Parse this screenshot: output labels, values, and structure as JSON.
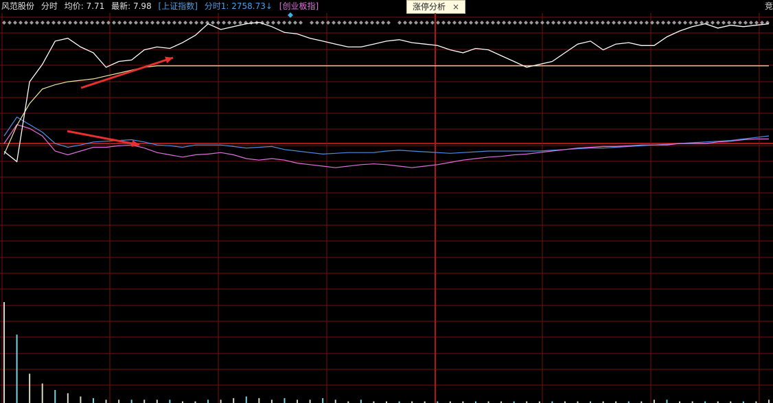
{
  "header": {
    "stock": "风范股份",
    "mode": "分时",
    "avg_label": "均价:",
    "avg_value": "7.71",
    "last_label": "最新:",
    "last_value": "7.98",
    "index_name": "[上证指数]",
    "index_time_label": "分时1:",
    "index_value": "2758.73",
    "index_arrow": "↓",
    "cy_index": "[创业板指]",
    "right_char": "竞"
  },
  "tag": {
    "label": "涨停分析",
    "close": "×"
  },
  "colors": {
    "grid": "#7a1010",
    "major_grid": "#b01818",
    "price": "#ffffff",
    "avg": "#f0e8a0",
    "index_sh": "#4a90e8",
    "index_cy": "#e070e0",
    "volume": "#d8d8c0",
    "volume_alt": "#70d8e0",
    "marker": "#3ab0e8",
    "annotation": "#e83030"
  },
  "chart_data": {
    "type": "line",
    "x": [
      0,
      4,
      8,
      12,
      16,
      20,
      24,
      28,
      32,
      36,
      40,
      44,
      48,
      52,
      56,
      60,
      64,
      68,
      72,
      76,
      80,
      84,
      88,
      92,
      96,
      100,
      104,
      108,
      112,
      116,
      120,
      124,
      128,
      132,
      136,
      140,
      144,
      148,
      152,
      156,
      160,
      164,
      168,
      172,
      176,
      180,
      184,
      188,
      192,
      196,
      200,
      204,
      208,
      212,
      216,
      220,
      224,
      228,
      232,
      236,
      240
    ],
    "series": [
      {
        "values": [
          7.12,
          7.05,
          7.6,
          7.72,
          7.88,
          7.9,
          7.84,
          7.8,
          7.7,
          7.74,
          7.75,
          7.82,
          7.84,
          7.83,
          7.87,
          7.92,
          8.0,
          7.96,
          7.98,
          8.0,
          8.01,
          7.98,
          7.94,
          7.93,
          7.9,
          7.88,
          7.86,
          7.84,
          7.84,
          7.86,
          7.88,
          7.89,
          7.87,
          7.86,
          7.85,
          7.82,
          7.8,
          7.83,
          7.82,
          7.78,
          7.74,
          7.7,
          7.72,
          7.74,
          7.8,
          7.86,
          7.88,
          7.82,
          7.86,
          7.87,
          7.85,
          7.85,
          7.91,
          7.95,
          7.98,
          8.0,
          7.97,
          7.99,
          7.98,
          7.99,
          8.0
        ]
      },
      {
        "values": [
          7.1,
          7.3,
          7.45,
          7.55,
          7.58,
          7.6,
          7.61,
          7.62,
          7.64,
          7.66,
          7.68,
          7.7,
          7.71,
          7.71,
          7.71,
          7.71,
          7.71,
          7.71,
          7.71,
          7.71,
          7.71,
          7.71,
          7.71,
          7.71,
          7.71,
          7.71,
          7.71,
          7.71,
          7.71,
          7.71,
          7.71,
          7.71,
          7.71,
          7.71,
          7.71,
          7.71,
          7.71,
          7.71,
          7.71,
          7.71,
          7.71,
          7.71,
          7.71,
          7.71,
          7.71,
          7.71,
          7.71,
          7.71,
          7.71,
          7.71,
          7.71,
          7.71,
          7.71,
          7.71,
          7.71,
          7.71,
          7.71,
          7.71,
          7.71,
          7.71,
          7.71
        ]
      }
    ],
    "index_series": [
      {
        "name": "[上证指数]",
        "values": [
          0.1,
          0.35,
          0.25,
          0.15,
          0.0,
          -0.05,
          -0.02,
          0.02,
          0.03,
          0.04,
          0.05,
          0.02,
          -0.02,
          -0.03,
          -0.05,
          -0.02,
          -0.02,
          -0.02,
          -0.04,
          -0.06,
          -0.05,
          -0.04,
          -0.08,
          -0.1,
          -0.12,
          -0.14,
          -0.13,
          -0.12,
          -0.12,
          -0.12,
          -0.1,
          -0.09,
          -0.1,
          -0.11,
          -0.12,
          -0.13,
          -0.12,
          -0.11,
          -0.1,
          -0.1,
          -0.1,
          -0.1,
          -0.1,
          -0.09,
          -0.08,
          -0.07,
          -0.06,
          -0.06,
          -0.05,
          -0.04,
          -0.03,
          -0.02,
          -0.01,
          0.0,
          0.01,
          0.02,
          0.03,
          0.04,
          0.06,
          0.08,
          0.1
        ]
      },
      {
        "name": "[创业板指]",
        "values": [
          0.0,
          0.25,
          0.2,
          0.1,
          -0.1,
          -0.15,
          -0.1,
          -0.05,
          -0.05,
          -0.03,
          -0.02,
          -0.06,
          -0.12,
          -0.15,
          -0.18,
          -0.15,
          -0.14,
          -0.12,
          -0.15,
          -0.2,
          -0.22,
          -0.2,
          -0.22,
          -0.26,
          -0.28,
          -0.3,
          -0.32,
          -0.3,
          -0.28,
          -0.27,
          -0.28,
          -0.3,
          -0.32,
          -0.3,
          -0.28,
          -0.25,
          -0.22,
          -0.2,
          -0.18,
          -0.17,
          -0.15,
          -0.14,
          -0.12,
          -0.1,
          -0.08,
          -0.06,
          -0.05,
          -0.04,
          -0.04,
          -0.03,
          -0.02,
          -0.02,
          -0.02,
          0.0,
          0.0,
          0.0,
          0.02,
          0.03,
          0.05,
          0.06,
          0.06
        ]
      }
    ],
    "volume": [
      62,
      42,
      18,
      12,
      8,
      6,
      4,
      3,
      2,
      2,
      2,
      2,
      2,
      2,
      1,
      1,
      2,
      2,
      3,
      4,
      3,
      2,
      3,
      2,
      2,
      3,
      2,
      1,
      2,
      1,
      1,
      1,
      1,
      1,
      1,
      1,
      1,
      1,
      1,
      1,
      1,
      1,
      1,
      1,
      1,
      1,
      1,
      1,
      1,
      1,
      1,
      2,
      2,
      1,
      1,
      1,
      1,
      1,
      1,
      1,
      2
    ],
    "ylim": [
      7.0,
      8.05
    ],
    "index_ylim": [
      -1.0,
      1.0
    ]
  }
}
